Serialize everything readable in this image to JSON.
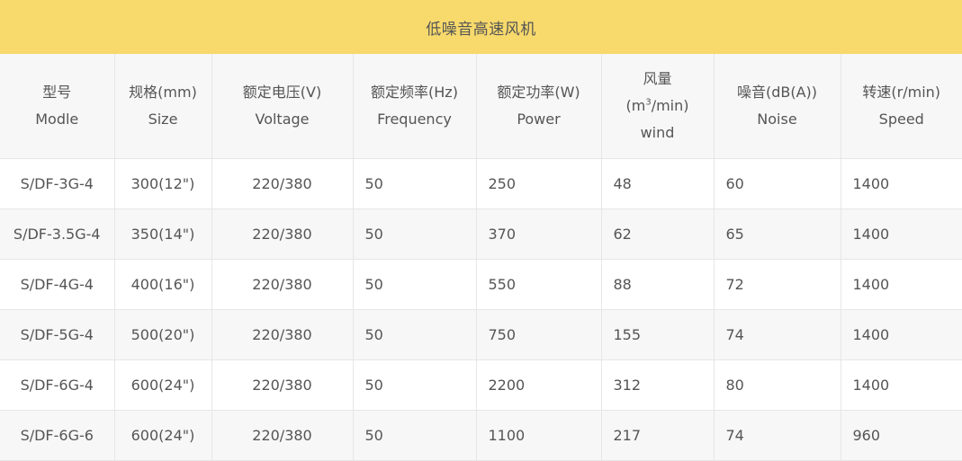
{
  "table": {
    "title": "低噪音高速风机",
    "headers": [
      {
        "cn": "型号",
        "en": "Modle"
      },
      {
        "cn": "规格(mm)",
        "en": "Size"
      },
      {
        "cn": "额定电压(V)",
        "en": "Voltage"
      },
      {
        "cn": "额定频率(Hz)",
        "en": "Frequency"
      },
      {
        "cn": "额定功率(W)",
        "en": "Power"
      },
      {
        "cn": "风量",
        "unit_pre": "(m",
        "unit_sup": "3",
        "unit_post": "/min)",
        "en": "wind"
      },
      {
        "cn": "噪音(dB(A))",
        "en": "Noise"
      },
      {
        "cn": "转速(r/min)",
        "en": "Speed"
      }
    ],
    "rows": [
      [
        "S/DF-3G-4",
        "300(12\")",
        "220/380",
        "50",
        "250",
        "48",
        "60",
        "1400"
      ],
      [
        "S/DF-3.5G-4",
        "350(14\")",
        "220/380",
        "50",
        "370",
        "62",
        "65",
        "1400"
      ],
      [
        "S/DF-4G-4",
        "400(16\")",
        "220/380",
        "50",
        "550",
        "88",
        "72",
        "1400"
      ],
      [
        "S/DF-5G-4",
        "500(20\")",
        "220/380",
        "50",
        "750",
        "155",
        "74",
        "1400"
      ],
      [
        "S/DF-6G-4",
        "600(24\")",
        "220/380",
        "50",
        "2200",
        "312",
        "80",
        "1400"
      ],
      [
        "S/DF-6G-6",
        "600(24\")",
        "220/380",
        "50",
        "1100",
        "217",
        "74",
        "960"
      ]
    ]
  },
  "colors": {
    "title_bg": "#f7d96c",
    "stripe_bg": "#f7f7f7",
    "text": "#555555",
    "border": "#e6e6e6"
  }
}
